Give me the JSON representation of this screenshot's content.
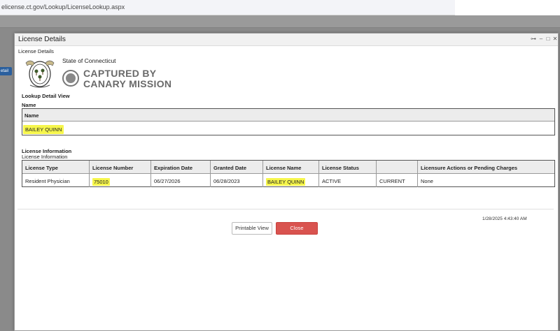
{
  "browser": {
    "url": "elicense.ct.gov/Lookup/LicenseLookup.aspx"
  },
  "background": {
    "button_label": "etail"
  },
  "modal": {
    "title": "License Details",
    "breadcrumb": "License Details",
    "state_name": "State of Connecticut",
    "watermark": {
      "line1": "CAPTURED BY",
      "line2": "CANARY MISSION"
    },
    "lookup_heading": "Lookup Detail View",
    "name_label": "Name",
    "name_table": {
      "header": "Name",
      "value": "BAILEY QUINN"
    },
    "license_heading": "License Information",
    "license_subheading": "License Information",
    "license_table": {
      "headers": [
        "License Type",
        "License Number",
        "Expiration Date",
        "Granted Date",
        "License Name",
        "License Status",
        "",
        "Licensure Actions or Pending Charges"
      ],
      "row": [
        "Resident Physician",
        "75010",
        "06/27/2026",
        "06/28/2023",
        "BAILEY QUINN",
        "ACTIVE",
        "CURRENT",
        "None"
      ]
    },
    "timestamp": "1/28/2025 4:43:40 AM",
    "buttons": {
      "printable": "Printable View",
      "close": "Close"
    }
  },
  "colors": {
    "highlight": "#f6f64c",
    "close_button": "#d9534f",
    "background_button": "#2a5f9e"
  }
}
